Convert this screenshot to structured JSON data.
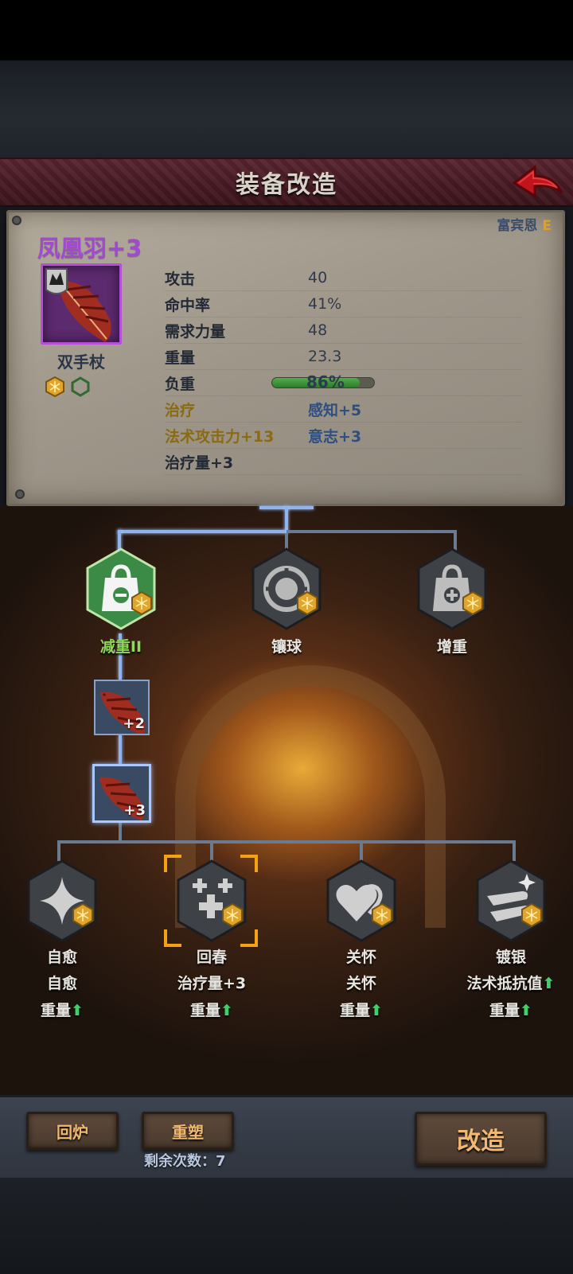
{
  "header": {
    "title": "装备改造"
  },
  "owner": {
    "name": "富宾恩",
    "grade": "E"
  },
  "item": {
    "name": "凤凰羽+3",
    "type": "双手杖",
    "load_percent": 86,
    "stats": [
      {
        "label": "攻击",
        "value": "40"
      },
      {
        "label": "命中率",
        "value": "41%"
      },
      {
        "label": "需求力量",
        "value": "48"
      },
      {
        "label": "重量",
        "value": "23.3"
      },
      {
        "label": "负重",
        "value": "86%"
      }
    ],
    "bonuses": [
      {
        "left": "治疗",
        "right": "感知+5"
      },
      {
        "left": "法术攻击力+13",
        "right": "意志+3"
      },
      {
        "left": "治疗量+3",
        "right": ""
      }
    ]
  },
  "tree": {
    "top_nodes": [
      {
        "name": "减重II",
        "icon": "bag-minus-icon",
        "active": true
      },
      {
        "name": "镶球",
        "icon": "orb-socket-icon",
        "active": false
      },
      {
        "name": "增重",
        "icon": "bag-plus-icon",
        "active": false
      }
    ],
    "levels": [
      {
        "label": "+2"
      },
      {
        "label": "+3"
      }
    ],
    "bottom_nodes": [
      {
        "name": "自愈",
        "effect": "自愈",
        "weight": "重量",
        "icon": "star-burst-icon"
      },
      {
        "name": "回春",
        "effect": "治疗量+3",
        "weight": "重量",
        "icon": "crosses-icon"
      },
      {
        "name": "关怀",
        "effect": "关怀",
        "weight": "重量",
        "icon": "hearts-icon"
      },
      {
        "name": "镀银",
        "effect": "法术抵抗值",
        "weight": "重量",
        "icon": "shine-icon"
      }
    ]
  },
  "actions": {
    "recycle": "回炉",
    "reshape": "重塑",
    "remain_label": "剩余次数：7",
    "modify": "改造"
  },
  "colors": {
    "accent_purple": "#a349d1",
    "grade_gold": "#e0a020",
    "active_line": "#8fb3ef",
    "green": "#8fd85a"
  }
}
